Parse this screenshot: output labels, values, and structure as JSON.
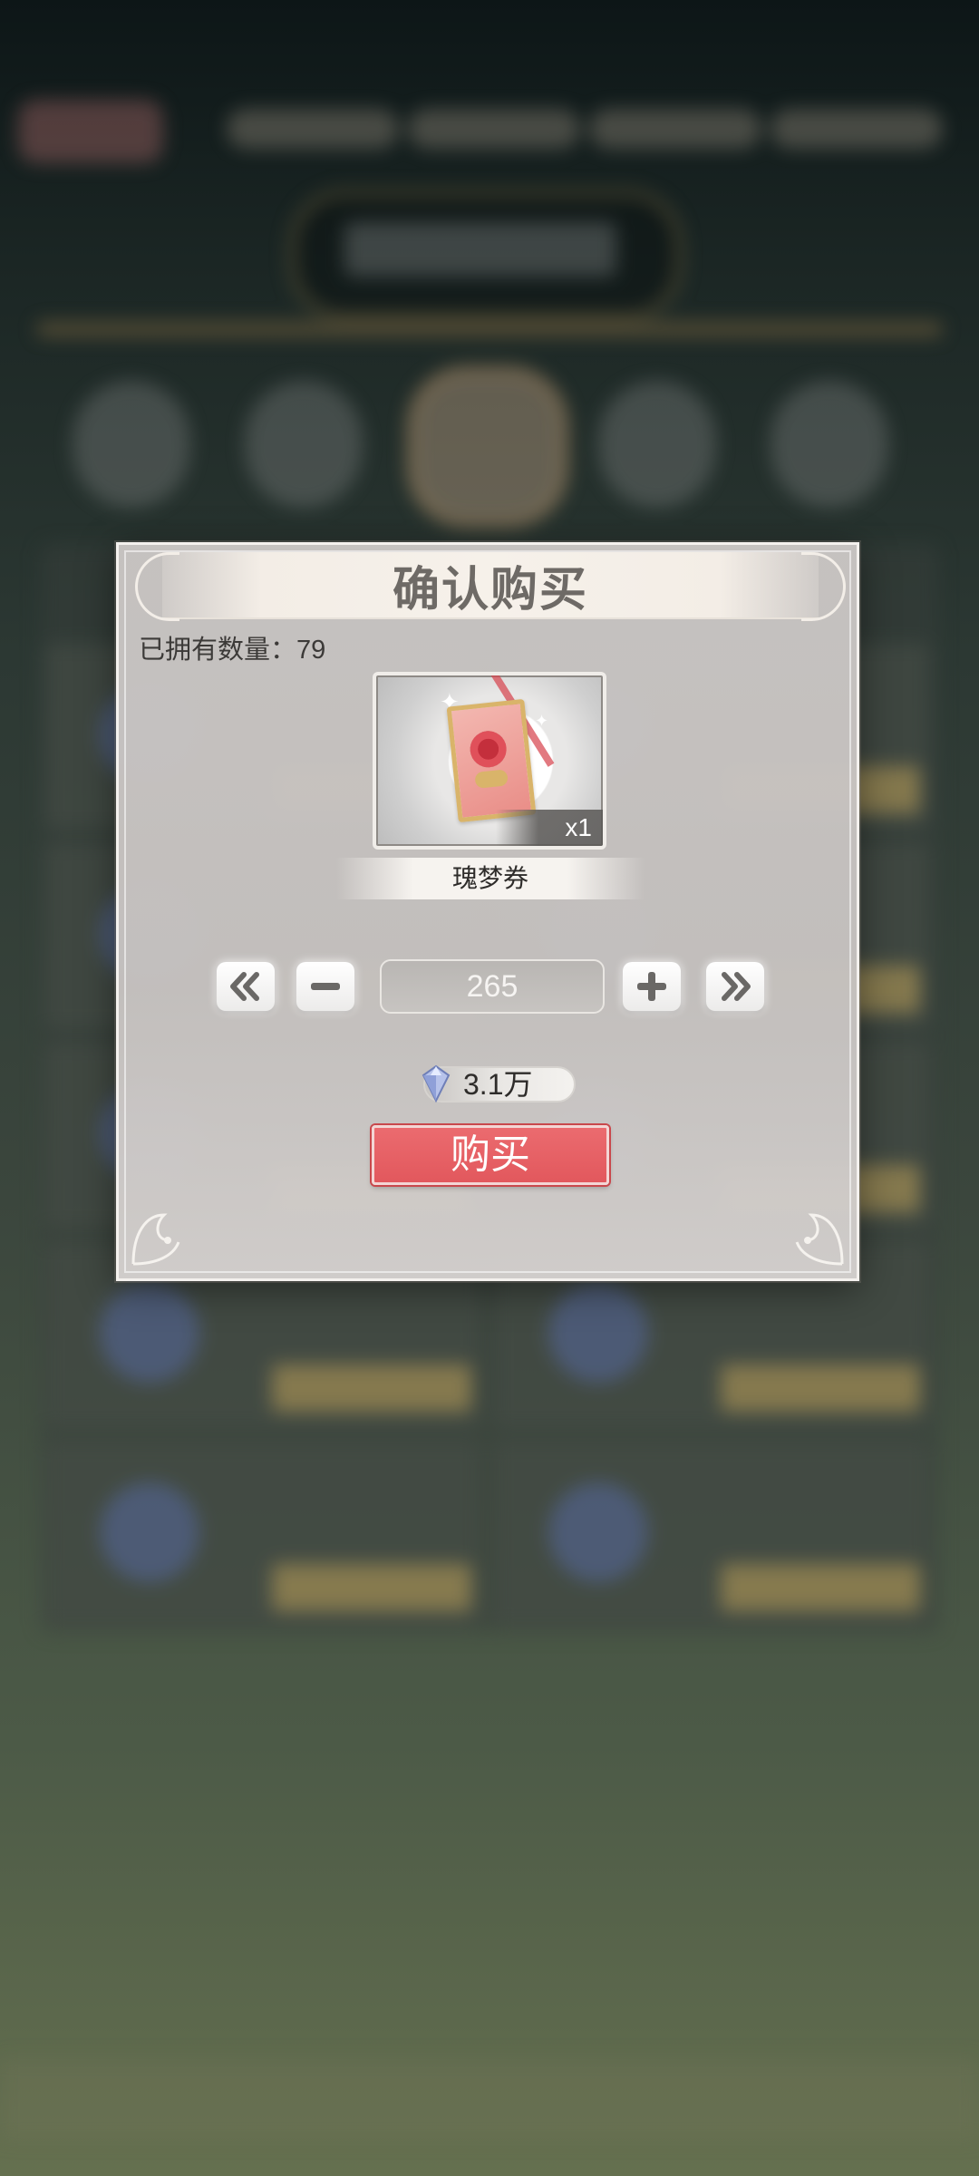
{
  "dialog": {
    "title": "确认购买",
    "owned_text": "已拥有数量：79"
  },
  "item": {
    "name": "瑰梦券",
    "quantity_tag": "x1",
    "icon": "rose-ticket-icon"
  },
  "quantity": {
    "value": "265",
    "buttons": [
      "min-icon",
      "minus-icon",
      "plus-icon",
      "max-icon"
    ]
  },
  "price": {
    "currency_icon": "diamond-icon",
    "amount": "3.1万"
  },
  "buy_label": "购买",
  "colors": {
    "buy_button": "#e2585d",
    "dialog_bg": "#c8c4c2",
    "title_text": "#6e6a66"
  }
}
